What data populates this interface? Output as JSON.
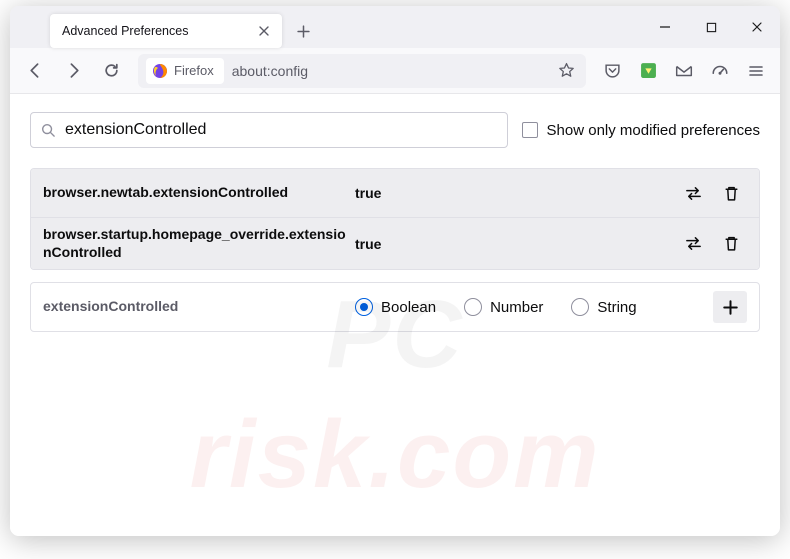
{
  "tab": {
    "title": "Advanced Preferences"
  },
  "addressbar": {
    "identity_label": "Firefox",
    "url": "about:config"
  },
  "search": {
    "value": "extensionControlled"
  },
  "show_modified": {
    "label": "Show only modified preferences"
  },
  "prefs": [
    {
      "name": "browser.newtab.extensionControlled",
      "value": "true"
    },
    {
      "name": "browser.startup.homepage_override.extensionControlled",
      "value": "true"
    }
  ],
  "new_pref": {
    "name": "extensionControlled",
    "types": {
      "boolean": "Boolean",
      "number": "Number",
      "string": "String"
    }
  }
}
